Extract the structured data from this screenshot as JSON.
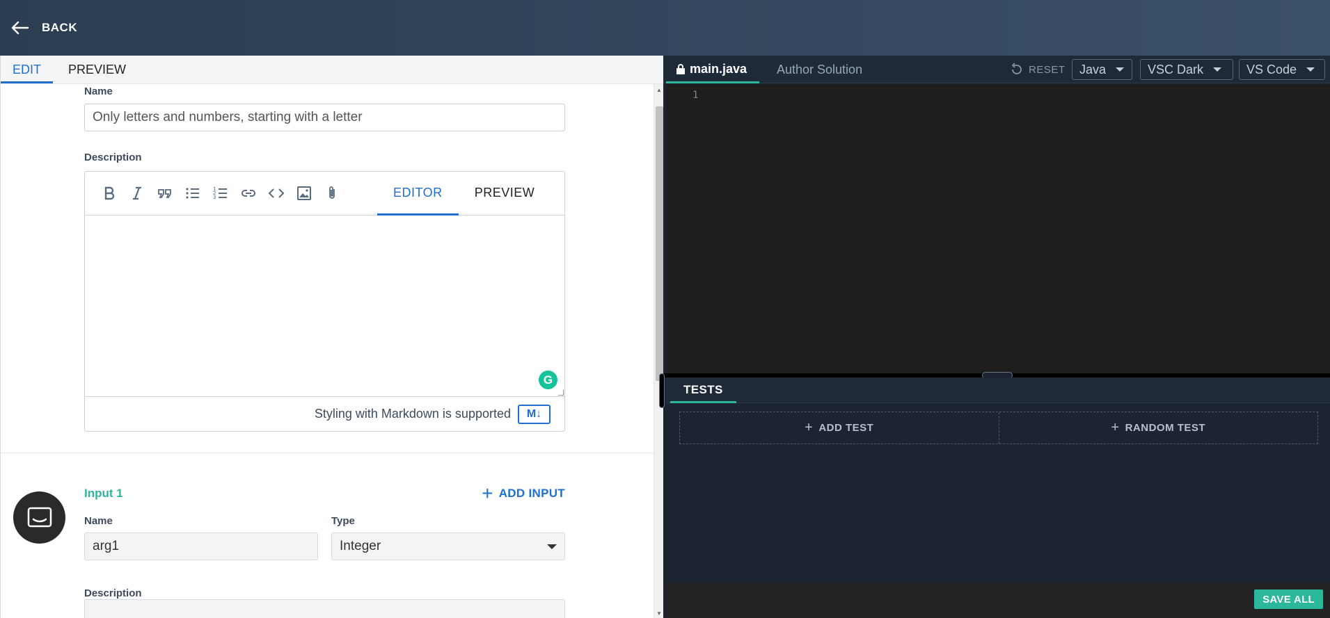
{
  "header": {
    "back_label": "BACK"
  },
  "left_tabs": [
    {
      "label": "EDIT"
    },
    {
      "label": "PREVIEW"
    }
  ],
  "form": {
    "name_label": "Name",
    "name_placeholder": "Only letters and numbers, starting with a letter",
    "description_label": "Description",
    "markdown_tabs": [
      {
        "label": "EDITOR"
      },
      {
        "label": "PREVIEW"
      }
    ],
    "markdown_note": "Styling with Markdown is supported",
    "markdown_badge": "M↓",
    "grammarly": "G"
  },
  "input_section": {
    "title": "Input 1",
    "add_input_label": "ADD INPUT",
    "name_label": "Name",
    "name_value": "arg1",
    "type_label": "Type",
    "type_value": "Integer",
    "description_label": "Description"
  },
  "editor": {
    "tabs": [
      {
        "label": "main.java"
      },
      {
        "label": "Author Solution"
      }
    ],
    "reset_label": "RESET",
    "language": "Java",
    "theme": "VSC Dark",
    "keymap": "VS Code",
    "line_number": "1"
  },
  "tests": {
    "tab_label": "TESTS",
    "add_test_label": "ADD TEST",
    "random_test_label": "RANDOM TEST"
  },
  "footer": {
    "save_all_label": "SAVE ALL"
  },
  "colors": {
    "accent_blue": "#1f6fd0",
    "accent_green": "#2bb79a",
    "header_bg": "#2b3d52"
  }
}
